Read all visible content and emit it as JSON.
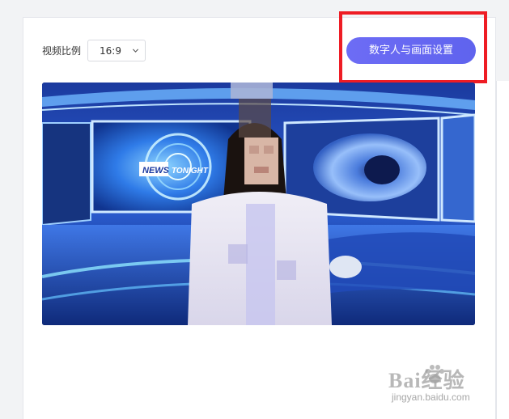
{
  "toolbar": {
    "ratio_label": "视频比例",
    "ratio_value": "16:9",
    "settings_button_label": "数字人与画面设置"
  },
  "preview": {
    "screen_text_primary": "NEWS",
    "screen_text_secondary": "TONIGHT"
  },
  "watermark": {
    "brand": "Bai经验",
    "url": "jingyan.baidu.com"
  },
  "colors": {
    "accent": "#6366f1",
    "highlight": "#ee1c24",
    "panel_bg": "#ffffff",
    "page_bg": "#f2f3f5"
  },
  "icons": {
    "select_chevron": "chevron-down-icon",
    "watermark_paw": "paw-icon"
  }
}
